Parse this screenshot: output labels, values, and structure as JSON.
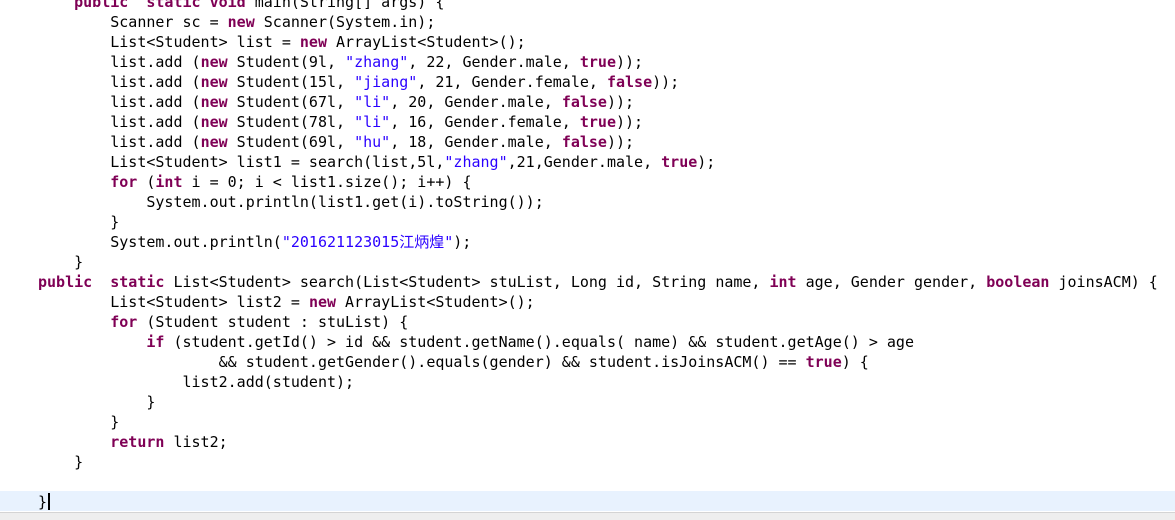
{
  "editor": {
    "language": "java",
    "colors": {
      "background": "#ffffff",
      "keyword": "#7f0055",
      "string": "#2a00ff",
      "text": "#000000",
      "current_line": "#e8f2fe"
    },
    "lines": [
      [
        {
          "t": "    "
        },
        {
          "t": "public",
          "k": "kw"
        },
        {
          "t": "  "
        },
        {
          "t": "static",
          "k": "kw"
        },
        {
          "t": " "
        },
        {
          "t": "void",
          "k": "kw"
        },
        {
          "t": " main(String[] args) {"
        }
      ],
      [
        {
          "t": "        Scanner sc = "
        },
        {
          "t": "new",
          "k": "kw"
        },
        {
          "t": " Scanner(System.in);"
        }
      ],
      [
        {
          "t": "        List<Student> list = "
        },
        {
          "t": "new",
          "k": "kw"
        },
        {
          "t": " ArrayList<Student>();"
        }
      ],
      [
        {
          "t": "        list.add ("
        },
        {
          "t": "new",
          "k": "kw"
        },
        {
          "t": " Student(9l, "
        },
        {
          "t": "\"zhang\"",
          "k": "str"
        },
        {
          "t": ", 22, Gender.male, "
        },
        {
          "t": "true",
          "k": "kw"
        },
        {
          "t": "));"
        }
      ],
      [
        {
          "t": "        list.add ("
        },
        {
          "t": "new",
          "k": "kw"
        },
        {
          "t": " Student(15l, "
        },
        {
          "t": "\"jiang\"",
          "k": "str"
        },
        {
          "t": ", 21, Gender.female, "
        },
        {
          "t": "false",
          "k": "kw"
        },
        {
          "t": "));"
        }
      ],
      [
        {
          "t": "        list.add ("
        },
        {
          "t": "new",
          "k": "kw"
        },
        {
          "t": " Student(67l, "
        },
        {
          "t": "\"li\"",
          "k": "str"
        },
        {
          "t": ", 20, Gender.male, "
        },
        {
          "t": "false",
          "k": "kw"
        },
        {
          "t": "));"
        }
      ],
      [
        {
          "t": "        list.add ("
        },
        {
          "t": "new",
          "k": "kw"
        },
        {
          "t": " Student(78l, "
        },
        {
          "t": "\"li\"",
          "k": "str"
        },
        {
          "t": ", 16, Gender.female, "
        },
        {
          "t": "true",
          "k": "kw"
        },
        {
          "t": "));"
        }
      ],
      [
        {
          "t": "        list.add ("
        },
        {
          "t": "new",
          "k": "kw"
        },
        {
          "t": " Student(69l, "
        },
        {
          "t": "\"hu\"",
          "k": "str"
        },
        {
          "t": ", 18, Gender.male, "
        },
        {
          "t": "false",
          "k": "kw"
        },
        {
          "t": "));"
        }
      ],
      [
        {
          "t": "        List<Student> list1 = search(list,5l,"
        },
        {
          "t": "\"zhang\"",
          "k": "str"
        },
        {
          "t": ",21,Gender.male, "
        },
        {
          "t": "true",
          "k": "kw"
        },
        {
          "t": ");"
        }
      ],
      [
        {
          "t": "        "
        },
        {
          "t": "for",
          "k": "kw"
        },
        {
          "t": " ("
        },
        {
          "t": "int",
          "k": "kw"
        },
        {
          "t": " i = 0; i < list1.size(); i++) {"
        }
      ],
      [
        {
          "t": "            System.out.println(list1.get(i).toString());"
        }
      ],
      [
        {
          "t": "        }"
        }
      ],
      [
        {
          "t": "        System.out.println("
        },
        {
          "t": "\"201621123015江炳煌\"",
          "k": "str"
        },
        {
          "t": ");"
        }
      ],
      [
        {
          "t": "    }"
        }
      ],
      [
        {
          "t": "public",
          "k": "kw"
        },
        {
          "t": "  "
        },
        {
          "t": "static",
          "k": "kw"
        },
        {
          "t": " List<Student> search(List<Student> stuList, Long id, String name, "
        },
        {
          "t": "int",
          "k": "kw"
        },
        {
          "t": " age, Gender gender, "
        },
        {
          "t": "boolean",
          "k": "kw"
        },
        {
          "t": " joinsACM) {"
        }
      ],
      [
        {
          "t": "        List<Student> list2 = "
        },
        {
          "t": "new",
          "k": "kw"
        },
        {
          "t": " ArrayList<Student>();"
        }
      ],
      [
        {
          "t": "        "
        },
        {
          "t": "for",
          "k": "kw"
        },
        {
          "t": " (Student student : stuList) {"
        }
      ],
      [
        {
          "t": "            "
        },
        {
          "t": "if",
          "k": "kw"
        },
        {
          "t": " (student.getId() > id && student.getName().equals( name) && student.getAge() > age"
        }
      ],
      [
        {
          "t": "                    && student.getGender().equals(gender) && student.isJoinsACM() == "
        },
        {
          "t": "true",
          "k": "kw"
        },
        {
          "t": ") {"
        }
      ],
      [
        {
          "t": "                list2.add(student);"
        }
      ],
      [
        {
          "t": "            }"
        }
      ],
      [
        {
          "t": "        }"
        }
      ],
      [
        {
          "t": "        "
        },
        {
          "t": "return",
          "k": "kw"
        },
        {
          "t": " list2;"
        }
      ],
      [
        {
          "t": "    }"
        }
      ],
      [
        {
          "t": ""
        }
      ],
      [
        {
          "t": "}"
        }
      ]
    ]
  }
}
